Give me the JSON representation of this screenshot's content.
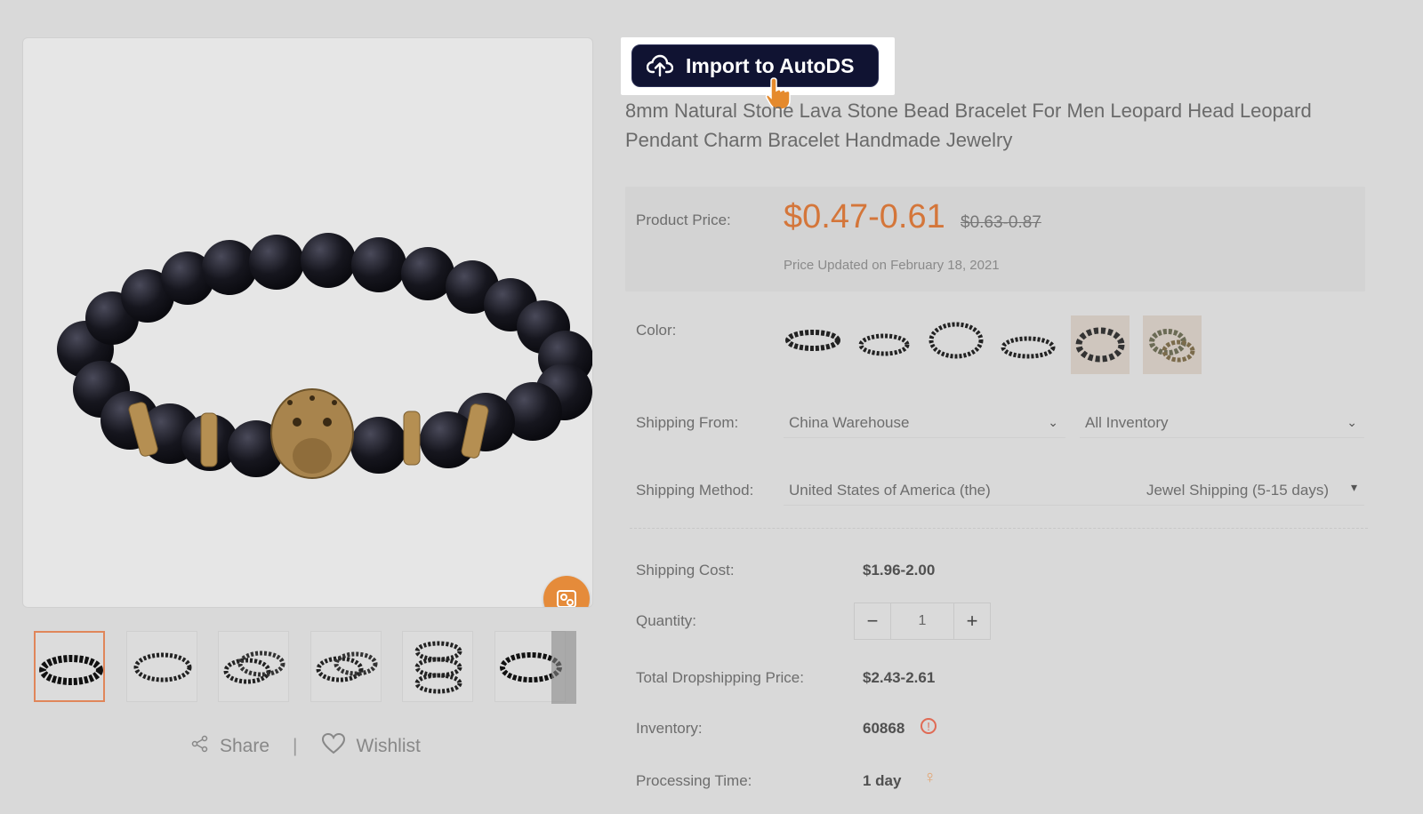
{
  "import": {
    "label": "Import to AutoDS"
  },
  "product": {
    "title": "8mm Natural Stone Lava Stone Bead Bracelet For Men Leopard Head Leopard Pendant Charm Bracelet Handmade Jewelry"
  },
  "price": {
    "label": "Product Price:",
    "current": "$0.47-0.61",
    "original": "$0.63-0.87",
    "updated": "Price Updated on February 18, 2021"
  },
  "color": {
    "label": "Color:",
    "swatch_count": 6
  },
  "shipping_from": {
    "label": "Shipping From:",
    "warehouse": "China Warehouse",
    "inventory": "All Inventory"
  },
  "shipping_method": {
    "label": "Shipping Method:",
    "country": "United States of America (the)",
    "method": "Jewel Shipping (5-15 days)"
  },
  "shipping_cost": {
    "label": "Shipping Cost:",
    "value": "$1.96-2.00"
  },
  "quantity": {
    "label": "Quantity:",
    "value": "1",
    "minus": "−",
    "plus": "+"
  },
  "total": {
    "label": "Total Dropshipping Price:",
    "value": "$2.43-2.61"
  },
  "inventory": {
    "label": "Inventory:",
    "value": "60868"
  },
  "processing": {
    "label": "Processing Time:",
    "value": "1 day"
  },
  "share": {
    "share_label": "Share",
    "separator": "|",
    "wishlist_label": "Wishlist"
  },
  "colors": {
    "accent": "#d4763a",
    "button_bg": "#101332",
    "overlay_bg": "#d9d9d9"
  }
}
